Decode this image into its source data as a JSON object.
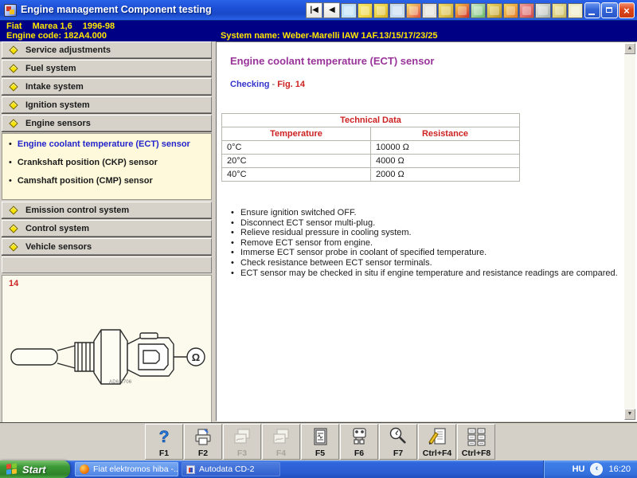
{
  "colors": {
    "titlebar_blue": "#1c4fd6",
    "header_navy": "#000084",
    "header_text_yellow": "#ffe600",
    "accent_red": "#cc2222",
    "title_purple": "#993399",
    "link_blue": "#3333cc",
    "panel_gray": "#d4d0c8",
    "subpanel_yellow": "#fdf9da",
    "figure_cream": "#fbfaec",
    "taskbar_blue": "#2a5cd0",
    "start_green": "#3d9a37"
  },
  "title_bar": {
    "title": "Engine management Component testing",
    "nav_first": "|◀",
    "nav_back": "◀",
    "window_buttons": [
      "minimize",
      "restore",
      "close"
    ]
  },
  "header": {
    "make": "Fiat",
    "model": "Marea 1,6",
    "years": "1996-98",
    "engine_code": "Engine code: 182A4.000",
    "system_name": "System name: Weber-Marelli IAW 1AF.13/15/17/23/25"
  },
  "sidebar": {
    "items": [
      {
        "label": "Service adjustments"
      },
      {
        "label": "Fuel system"
      },
      {
        "label": "Intake system"
      },
      {
        "label": "Ignition system"
      },
      {
        "label": "Engine sensors"
      },
      {
        "label": "Emission control system"
      },
      {
        "label": "Control system"
      },
      {
        "label": "Vehicle sensors"
      }
    ],
    "subitems": [
      {
        "label": "Engine coolant temperature (ECT) sensor",
        "active": true
      },
      {
        "label": "Crankshaft position (CKP) sensor",
        "active": false
      },
      {
        "label": "Camshaft position (CMP) sensor",
        "active": false
      }
    ],
    "figure_number": "14",
    "figure_code": "AD6.2706",
    "ohm_symbol": "Ω"
  },
  "content": {
    "title": "Engine coolant temperature (ECT) sensor",
    "checking_label": "Checking",
    "separator": "-",
    "fig_ref": "Fig. 14",
    "table": {
      "title": "Technical Data",
      "columns": [
        "Temperature",
        "Resistance"
      ],
      "rows": [
        [
          "0°C",
          "10000 Ω"
        ],
        [
          "20°C",
          "4000 Ω"
        ],
        [
          "40°C",
          "2000 Ω"
        ]
      ]
    },
    "bullets": [
      "Ensure ignition switched OFF.",
      "Disconnect ECT sensor multi-plug.",
      "Relieve residual pressure in cooling system.",
      "Remove ECT sensor from engine.",
      "Immerse ECT sensor probe in coolant of specified temperature.",
      "Check resistance between ECT sensor terminals.",
      "ECT sensor may be checked in situ if engine temperature and resistance readings are compared."
    ]
  },
  "fkey_bar": {
    "buttons": [
      {
        "key": "F1",
        "icon": "help",
        "enabled": true
      },
      {
        "key": "F2",
        "icon": "print",
        "enabled": true
      },
      {
        "key": "F3",
        "icon": "images",
        "enabled": false
      },
      {
        "key": "F4",
        "icon": "images",
        "enabled": false
      },
      {
        "key": "F5",
        "icon": "wiring-diagram",
        "enabled": true
      },
      {
        "key": "F6",
        "icon": "connector",
        "enabled": true
      },
      {
        "key": "F7",
        "icon": "search",
        "enabled": true
      },
      {
        "key": "Ctrl+F4",
        "icon": "notes",
        "enabled": true
      },
      {
        "key": "Ctrl+F8",
        "icon": "data-table",
        "enabled": true
      }
    ]
  },
  "taskbar": {
    "start_label": "Start",
    "tasks": [
      {
        "label": "Fiat elektromos hiba -...",
        "icon": "firefox"
      },
      {
        "label": "Autodata CD-2",
        "icon": "autodata"
      }
    ],
    "tray": {
      "language": "HU",
      "chevron": "‹",
      "time": "16:20"
    }
  }
}
